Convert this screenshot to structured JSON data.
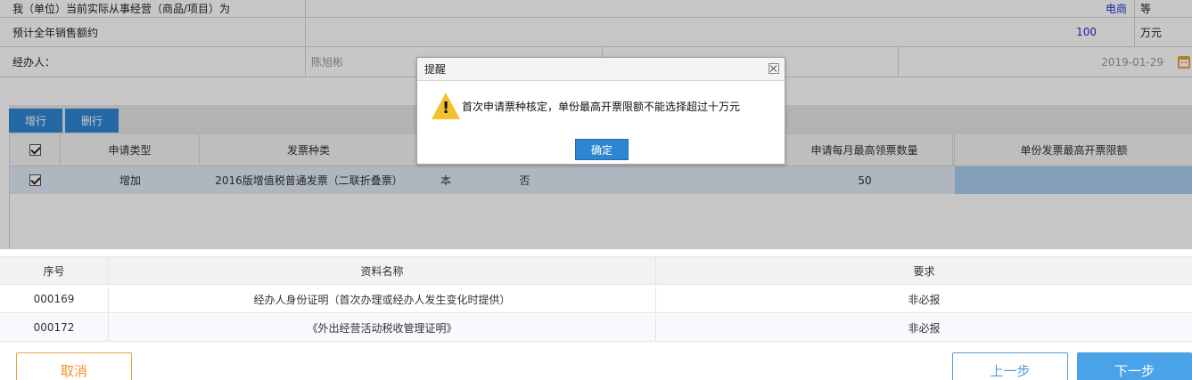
{
  "form": {
    "business_label": "我（单位）当前实际从事经营（商品/项目）为",
    "business_value": "电商",
    "business_unit": "等",
    "sales_label": "预计全年销售额约",
    "sales_value": "100",
    "sales_unit": "万元",
    "handler_label": "经办人：",
    "handler_value": "陈旭彬",
    "date_value": "2019-01-29"
  },
  "toolbar": {
    "add_row": "增行",
    "delete_row": "删行"
  },
  "grid": {
    "headers": [
      "申请类型",
      "发票种类",
      "申请每月最高领票数量",
      "单份发票最高开票限额"
    ],
    "row": {
      "type": "增加",
      "invoice_kind": "2016版增值税普通发票（二联折叠票）",
      "unit": "本",
      "flag": "否",
      "monthly_qty": "50",
      "limit": ""
    }
  },
  "materials": {
    "headers": [
      "序号",
      "资料名称",
      "要求"
    ],
    "rows": [
      {
        "no": "000169",
        "name": "经办人身份证明（首次办理或经办人发生变化时提供）",
        "req": "非必报"
      },
      {
        "no": "000172",
        "name": "《外出经营活动税收管理证明》",
        "req": "非必报"
      }
    ]
  },
  "buttons": {
    "cancel": "取消",
    "prev": "上一步",
    "next": "下一步"
  },
  "dialog": {
    "title": "提醒",
    "message": "首次申请票种核定，单份最高开票限额不能选择超过十万元",
    "ok": "确定",
    "icon": "warning-icon"
  }
}
